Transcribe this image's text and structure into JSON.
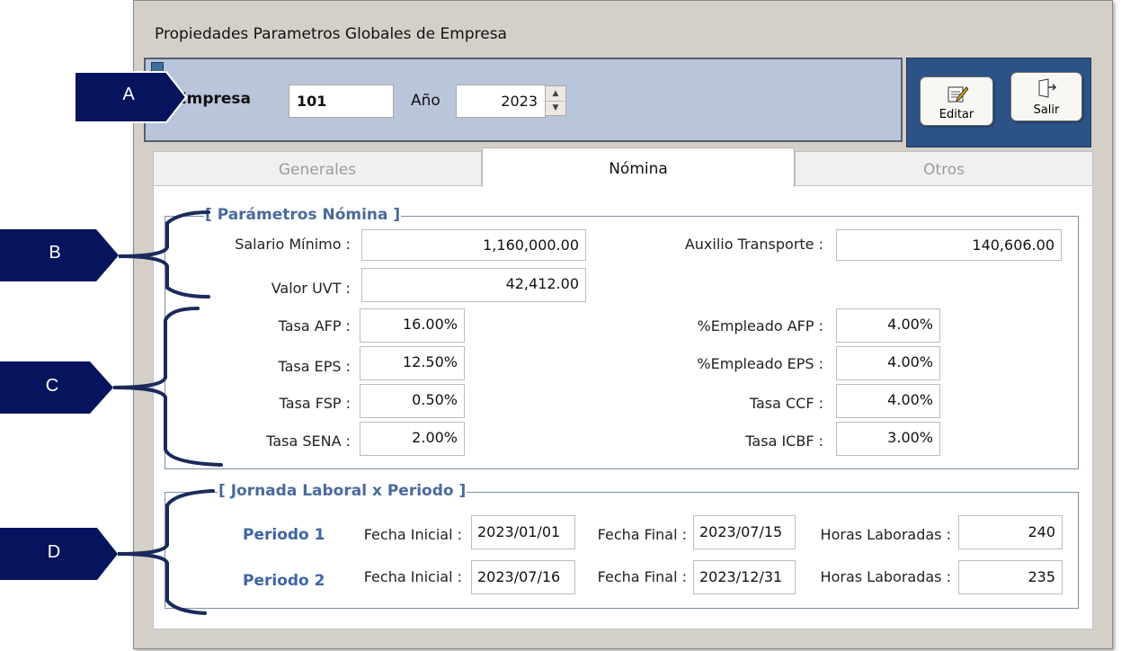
{
  "window": {
    "title": "Propiedades Parametros Globales de Empresa"
  },
  "header": {
    "empresa_label": "Empresa",
    "empresa_value": "101",
    "anio_label": "Año",
    "anio_value": "2023"
  },
  "toolbar": {
    "editar_label": "Editar",
    "salir_label": "Salir"
  },
  "tabs": [
    {
      "label": "Generales",
      "active": false
    },
    {
      "label": "Nómina",
      "active": true
    },
    {
      "label": "Otros",
      "active": false
    }
  ],
  "parametros": {
    "title": "[ Parámetros Nómina ]",
    "salario_minimo": {
      "label": "Salario Mínimo :",
      "value": "1,160,000.00"
    },
    "auxilio_transporte": {
      "label": "Auxilio Transporte :",
      "value": "140,606.00"
    },
    "valor_uvt": {
      "label": "Valor UVT :",
      "value": "42,412.00"
    },
    "tasa_afp": {
      "label": "Tasa AFP :",
      "value": "16.00%"
    },
    "tasa_eps": {
      "label": "Tasa EPS :",
      "value": "12.50%"
    },
    "tasa_fsp": {
      "label": "Tasa FSP :",
      "value": "0.50%"
    },
    "tasa_sena": {
      "label": "Tasa SENA :",
      "value": "2.00%"
    },
    "empleado_afp": {
      "label": "%Empleado AFP :",
      "value": "4.00%"
    },
    "empleado_eps": {
      "label": "%Empleado EPS :",
      "value": "4.00%"
    },
    "tasa_ccf": {
      "label": "Tasa CCF :",
      "value": "4.00%"
    },
    "tasa_icbf": {
      "label": "Tasa ICBF :",
      "value": "3.00%"
    }
  },
  "jornada": {
    "title": "[ Jornada Laboral x Periodo ]",
    "fecha_inicial_label": "Fecha Inicial :",
    "fecha_final_label": "Fecha Final :",
    "horas_label": "Horas Laboradas :",
    "periodos": [
      {
        "name": "Periodo 1",
        "fecha_inicial": "2023/01/01",
        "fecha_final": "2023/07/15",
        "horas": "240"
      },
      {
        "name": "Periodo 2",
        "fecha_inicial": "2023/07/16",
        "fecha_final": "2023/12/31",
        "horas": "235"
      }
    ]
  },
  "callouts": [
    "A",
    "B",
    "C",
    "D"
  ],
  "colors": {
    "callout_bg": "#06145e",
    "group_title": "#4a6a9c",
    "periodo": "#3e65a4",
    "button_panel": "#2d5288"
  }
}
